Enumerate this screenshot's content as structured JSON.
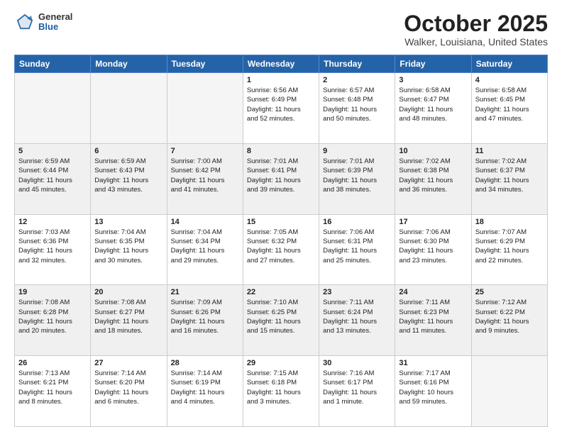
{
  "logo": {
    "general": "General",
    "blue": "Blue"
  },
  "header": {
    "month": "October 2025",
    "location": "Walker, Louisiana, United States"
  },
  "weekdays": [
    "Sunday",
    "Monday",
    "Tuesday",
    "Wednesday",
    "Thursday",
    "Friday",
    "Saturday"
  ],
  "weeks": [
    [
      {
        "day": "",
        "info": ""
      },
      {
        "day": "",
        "info": ""
      },
      {
        "day": "",
        "info": ""
      },
      {
        "day": "1",
        "info": "Sunrise: 6:56 AM\nSunset: 6:49 PM\nDaylight: 11 hours\nand 52 minutes."
      },
      {
        "day": "2",
        "info": "Sunrise: 6:57 AM\nSunset: 6:48 PM\nDaylight: 11 hours\nand 50 minutes."
      },
      {
        "day": "3",
        "info": "Sunrise: 6:58 AM\nSunset: 6:47 PM\nDaylight: 11 hours\nand 48 minutes."
      },
      {
        "day": "4",
        "info": "Sunrise: 6:58 AM\nSunset: 6:45 PM\nDaylight: 11 hours\nand 47 minutes."
      }
    ],
    [
      {
        "day": "5",
        "info": "Sunrise: 6:59 AM\nSunset: 6:44 PM\nDaylight: 11 hours\nand 45 minutes."
      },
      {
        "day": "6",
        "info": "Sunrise: 6:59 AM\nSunset: 6:43 PM\nDaylight: 11 hours\nand 43 minutes."
      },
      {
        "day": "7",
        "info": "Sunrise: 7:00 AM\nSunset: 6:42 PM\nDaylight: 11 hours\nand 41 minutes."
      },
      {
        "day": "8",
        "info": "Sunrise: 7:01 AM\nSunset: 6:41 PM\nDaylight: 11 hours\nand 39 minutes."
      },
      {
        "day": "9",
        "info": "Sunrise: 7:01 AM\nSunset: 6:39 PM\nDaylight: 11 hours\nand 38 minutes."
      },
      {
        "day": "10",
        "info": "Sunrise: 7:02 AM\nSunset: 6:38 PM\nDaylight: 11 hours\nand 36 minutes."
      },
      {
        "day": "11",
        "info": "Sunrise: 7:02 AM\nSunset: 6:37 PM\nDaylight: 11 hours\nand 34 minutes."
      }
    ],
    [
      {
        "day": "12",
        "info": "Sunrise: 7:03 AM\nSunset: 6:36 PM\nDaylight: 11 hours\nand 32 minutes."
      },
      {
        "day": "13",
        "info": "Sunrise: 7:04 AM\nSunset: 6:35 PM\nDaylight: 11 hours\nand 30 minutes."
      },
      {
        "day": "14",
        "info": "Sunrise: 7:04 AM\nSunset: 6:34 PM\nDaylight: 11 hours\nand 29 minutes."
      },
      {
        "day": "15",
        "info": "Sunrise: 7:05 AM\nSunset: 6:32 PM\nDaylight: 11 hours\nand 27 minutes."
      },
      {
        "day": "16",
        "info": "Sunrise: 7:06 AM\nSunset: 6:31 PM\nDaylight: 11 hours\nand 25 minutes."
      },
      {
        "day": "17",
        "info": "Sunrise: 7:06 AM\nSunset: 6:30 PM\nDaylight: 11 hours\nand 23 minutes."
      },
      {
        "day": "18",
        "info": "Sunrise: 7:07 AM\nSunset: 6:29 PM\nDaylight: 11 hours\nand 22 minutes."
      }
    ],
    [
      {
        "day": "19",
        "info": "Sunrise: 7:08 AM\nSunset: 6:28 PM\nDaylight: 11 hours\nand 20 minutes."
      },
      {
        "day": "20",
        "info": "Sunrise: 7:08 AM\nSunset: 6:27 PM\nDaylight: 11 hours\nand 18 minutes."
      },
      {
        "day": "21",
        "info": "Sunrise: 7:09 AM\nSunset: 6:26 PM\nDaylight: 11 hours\nand 16 minutes."
      },
      {
        "day": "22",
        "info": "Sunrise: 7:10 AM\nSunset: 6:25 PM\nDaylight: 11 hours\nand 15 minutes."
      },
      {
        "day": "23",
        "info": "Sunrise: 7:11 AM\nSunset: 6:24 PM\nDaylight: 11 hours\nand 13 minutes."
      },
      {
        "day": "24",
        "info": "Sunrise: 7:11 AM\nSunset: 6:23 PM\nDaylight: 11 hours\nand 11 minutes."
      },
      {
        "day": "25",
        "info": "Sunrise: 7:12 AM\nSunset: 6:22 PM\nDaylight: 11 hours\nand 9 minutes."
      }
    ],
    [
      {
        "day": "26",
        "info": "Sunrise: 7:13 AM\nSunset: 6:21 PM\nDaylight: 11 hours\nand 8 minutes."
      },
      {
        "day": "27",
        "info": "Sunrise: 7:14 AM\nSunset: 6:20 PM\nDaylight: 11 hours\nand 6 minutes."
      },
      {
        "day": "28",
        "info": "Sunrise: 7:14 AM\nSunset: 6:19 PM\nDaylight: 11 hours\nand 4 minutes."
      },
      {
        "day": "29",
        "info": "Sunrise: 7:15 AM\nSunset: 6:18 PM\nDaylight: 11 hours\nand 3 minutes."
      },
      {
        "day": "30",
        "info": "Sunrise: 7:16 AM\nSunset: 6:17 PM\nDaylight: 11 hours\nand 1 minute."
      },
      {
        "day": "31",
        "info": "Sunrise: 7:17 AM\nSunset: 6:16 PM\nDaylight: 10 hours\nand 59 minutes."
      },
      {
        "day": "",
        "info": ""
      }
    ]
  ]
}
